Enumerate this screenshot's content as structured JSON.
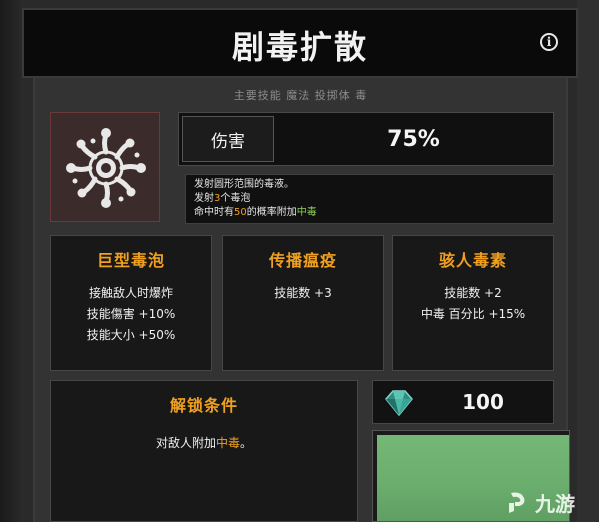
{
  "skill": {
    "title": "剧毒扩散",
    "tags": "主要技能  魔法  投掷体  毒",
    "icon": "poison-burst-icon"
  },
  "damage": {
    "label": "伤害",
    "value": "75%"
  },
  "description": {
    "line1": "发射圆形范围的毒液。",
    "line2_prefix": "发射",
    "line2_value": "3",
    "line2_suffix": "个毒泡",
    "line3_prefix": "命中时有",
    "line3_value": "50",
    "line3_mid": "的概率附加",
    "line3_status": "中毒"
  },
  "modifiers": [
    {
      "title": "巨型毒泡",
      "lines": [
        "接触敌人时爆炸",
        "技能傷害 +10%",
        "技能大小 +50%"
      ]
    },
    {
      "title": "传播瘟疫",
      "lines": [
        "技能数 +3"
      ]
    },
    {
      "title": "骇人毒素",
      "lines": [
        "技能数 +2",
        "中毒 百分比 +15%"
      ]
    }
  ],
  "unlock": {
    "title": "解锁条件",
    "text_prefix": "对敌人附加",
    "text_status": "中毒",
    "text_suffix": "。"
  },
  "cost": {
    "icon": "gem-icon",
    "value": "100"
  },
  "watermark": {
    "text": "九游",
    "icon": "jiuyou-logo-icon"
  },
  "colors": {
    "accent_orange": "#f0a020",
    "status_green": "#8fcf5a",
    "button_green": "#6aad6d",
    "gem_teal": "#3fa89a"
  }
}
